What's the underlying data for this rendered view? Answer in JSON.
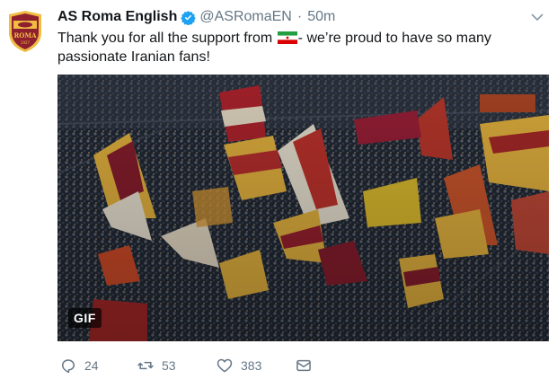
{
  "tweet": {
    "display_name": "AS Roma English",
    "handle": "@ASRomaEN",
    "separator": "·",
    "time": "50m",
    "text_before_flag": "Thank you for all the support from ",
    "flag_icon": "iran-flag-icon",
    "text_after_flag": "- we’re proud to have so many passionate Iranian fans!",
    "avatar_text": "ROMA",
    "avatar_year": "1927"
  },
  "media": {
    "badge": "GIF",
    "description_icon": "stadium-flags-image"
  },
  "actions": {
    "reply_count": "24",
    "retweet_count": "53",
    "like_count": "383"
  },
  "colors": {
    "verified": "#1da1f2",
    "roma_maroon": "#8e1f2f",
    "roma_yellow": "#f0bc42",
    "icon_grey": "#657786"
  }
}
